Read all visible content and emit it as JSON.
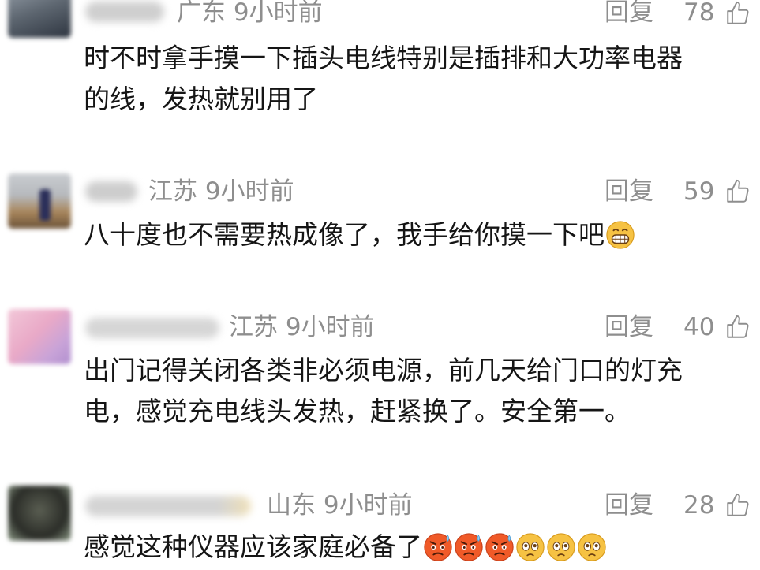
{
  "reply_label": "回复",
  "comments": [
    {
      "location_time": "广东  9小时前",
      "likes": "78",
      "lines": [
        "时不时拿手摸一下插头电线特别是插排和大功率电器",
        "的线，发热就别用了"
      ]
    },
    {
      "location_time": "江苏  9小时前",
      "likes": "59",
      "lines": [
        "八十度也不需要热成像了，我手给你摸一下吧"
      ],
      "emojis": [
        "grin"
      ]
    },
    {
      "location_time": "江苏  9小时前",
      "likes": "40",
      "lines": [
        "出门记得关闭各类非必须电源，前几天给门口的灯充",
        "电，感觉充电线头发热，赶紧换了。安全第一。"
      ]
    },
    {
      "location_time": "山东  9小时前",
      "likes": "28",
      "lines": [
        "感觉这种仪器应该家庭必备了"
      ],
      "emojis": [
        "angry-sweat",
        "angry-sweat",
        "angry-sweat",
        "pleading",
        "pleading",
        "pleading"
      ]
    }
  ],
  "colors": {
    "meta": "#8e8e8e",
    "text": "#151515",
    "emoji_face": "#f6c243",
    "emoji_angry": "#f05a28"
  }
}
